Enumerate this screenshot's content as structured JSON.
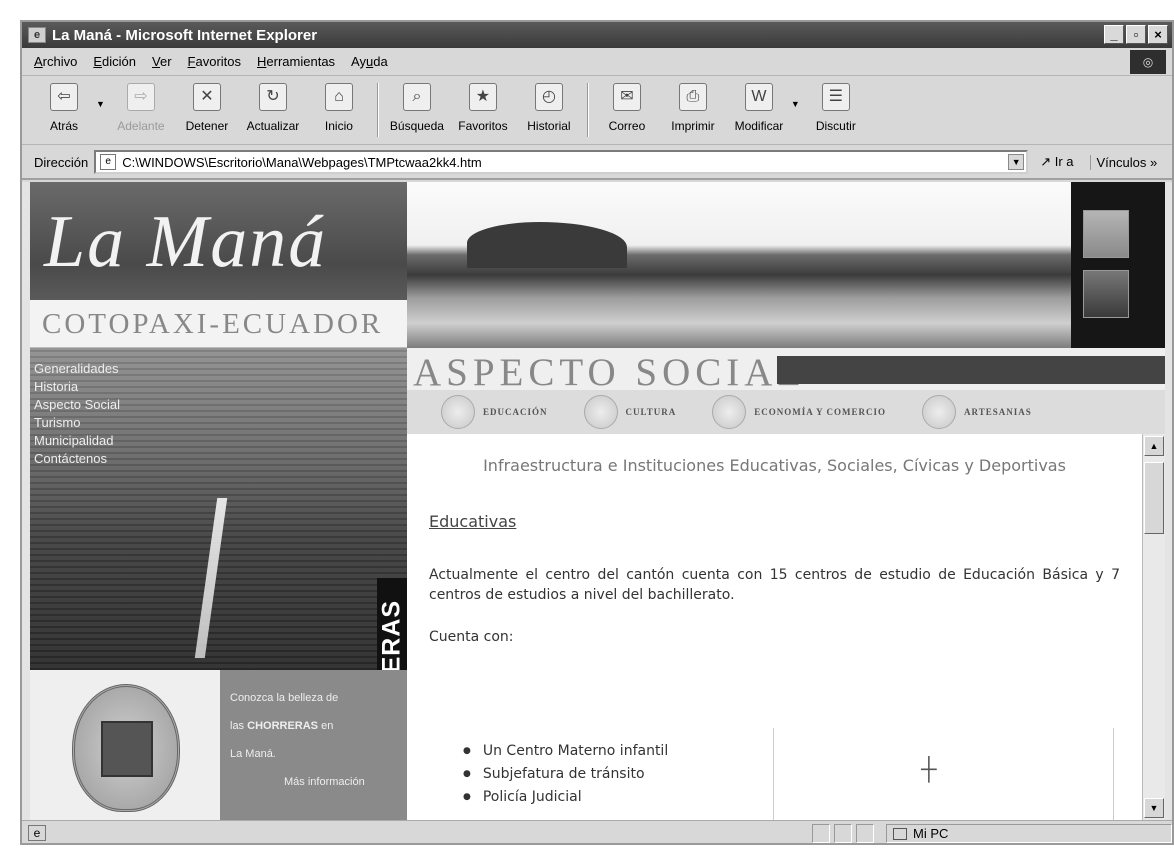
{
  "window": {
    "title": "La Maná - Microsoft Internet Explorer",
    "controls": [
      "_",
      "▫",
      "×"
    ]
  },
  "menubar": {
    "items": [
      {
        "pre": "",
        "key": "A",
        "post": "rchivo"
      },
      {
        "pre": "",
        "key": "E",
        "post": "dición"
      },
      {
        "pre": "",
        "key": "V",
        "post": "er"
      },
      {
        "pre": "",
        "key": "F",
        "post": "avoritos"
      },
      {
        "pre": "",
        "key": "H",
        "post": "erramientas"
      },
      {
        "pre": "Ay",
        "key": "u",
        "post": "da"
      }
    ]
  },
  "toolbar": {
    "back": "Atrás",
    "forward": "Adelante",
    "stop": "Detener",
    "refresh": "Actualizar",
    "home": "Inicio",
    "search": "Búsqueda",
    "favorites": "Favoritos",
    "history": "Historial",
    "mail": "Correo",
    "print": "Imprimir",
    "edit": "Modificar",
    "discuss": "Discutir"
  },
  "address": {
    "label": "Dirección",
    "value": "C:\\WINDOWS\\Escritorio\\Mana\\Webpages\\TMPtcwaa2kk4.htm",
    "go": "Ir a",
    "links": "Vínculos »"
  },
  "site": {
    "brand_title": "La Maná",
    "brand_subtitle": "COTOPAXI-ECUADOR",
    "nav": [
      "Generalidades",
      "Historia",
      "Aspecto Social",
      "Turismo",
      "Municipalidad",
      "Contáctenos"
    ],
    "vertical_tab": "CHORRERAS",
    "promo": {
      "line1": "Conozca la belleza de",
      "line2_pre": "las ",
      "line2_bold": "CHORRERAS",
      "line2_post": " en",
      "line3": "La Maná.",
      "line4": "Más información"
    },
    "section_title": "ASPECTO SOCIAL",
    "subnav": [
      "EDUCACIÓN",
      "CULTURA",
      "ECONOMÍA Y COMERCIO",
      "ARTESANIAS"
    ]
  },
  "content": {
    "heading": "Infraestructura e Instituciones Educativas, Sociales, Cívicas y Deportivas",
    "subheading": "Educativas",
    "paragraph": "Actualmente el centro del cantón cuenta con 15 centros de estudio de Educación Básica y 7 centros de estudios a nivel del bachillerato.",
    "intro": "Cuenta con:",
    "list": [
      "Un Centro Materno infantil",
      "Subjefatura de tránsito",
      "Policía Judicial"
    ]
  },
  "statusbar": {
    "zone": "Mi PC"
  }
}
